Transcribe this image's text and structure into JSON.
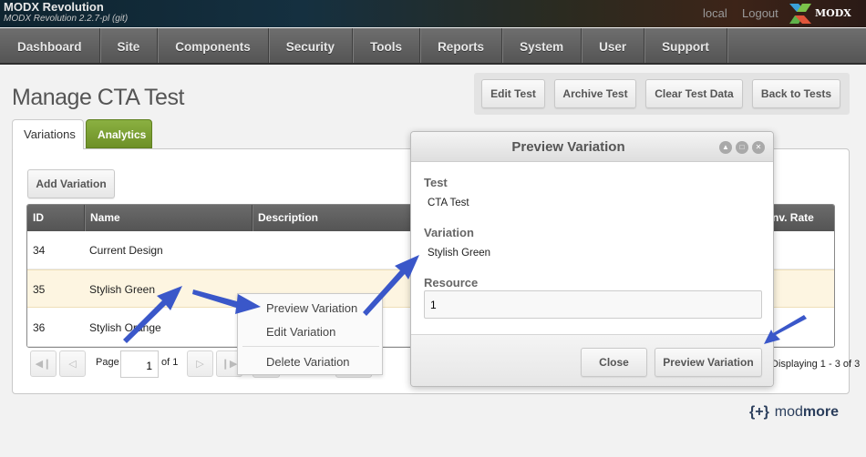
{
  "header": {
    "app_title": "MODX Revolution",
    "app_version": "MODX Revolution 2.2.7-pl (git)",
    "user_link": "local",
    "logout_link": "Logout",
    "logo_text": "MODX"
  },
  "nav": {
    "items": [
      {
        "label": "Dashboard"
      },
      {
        "label": "Site"
      },
      {
        "label": "Components"
      },
      {
        "label": "Security"
      },
      {
        "label": "Tools"
      },
      {
        "label": "Reports"
      },
      {
        "label": "System"
      },
      {
        "label": "User"
      },
      {
        "label": "Support"
      }
    ]
  },
  "page": {
    "title": "Manage CTA Test",
    "actions": {
      "edit": "Edit Test",
      "archive": "Archive Test",
      "clear": "Clear Test Data",
      "back": "Back to Tests"
    },
    "tabs": [
      {
        "label": "Variations",
        "active": true
      },
      {
        "label": "Analytics",
        "active": false
      }
    ],
    "add_variation": "Add Variation"
  },
  "grid": {
    "columns": [
      "ID",
      "Name",
      "Description",
      "Conv. Rate"
    ],
    "rows": [
      {
        "id": "34",
        "name": "Current Design",
        "selected": false
      },
      {
        "id": "35",
        "name": "Stylish Green",
        "selected": true
      },
      {
        "id": "36",
        "name": "Stylish Orange",
        "selected": false
      }
    ],
    "pager": {
      "page_label": "Page",
      "page_value": "1",
      "of_label": "of 1",
      "displaying": "Displaying 1 - 3 of 3"
    }
  },
  "context_menu": {
    "items": [
      "Preview Variation",
      "Edit Variation",
      "Delete Variation"
    ]
  },
  "modal": {
    "title": "Preview Variation",
    "test_label": "Test",
    "test_value": "CTA Test",
    "variation_label": "Variation",
    "variation_value": "Stylish Green",
    "resource_label": "Resource",
    "resource_value": "1",
    "close_button": "Close",
    "preview_button": "Preview Variation"
  },
  "footer": {
    "brand_brace": "{+}",
    "brand_light": "mod",
    "brand_bold": "more"
  },
  "colors": {
    "accent_green": "#7a9e30",
    "annotation_arrow": "#3a57c9",
    "selected_row": "#fdf5e1"
  }
}
